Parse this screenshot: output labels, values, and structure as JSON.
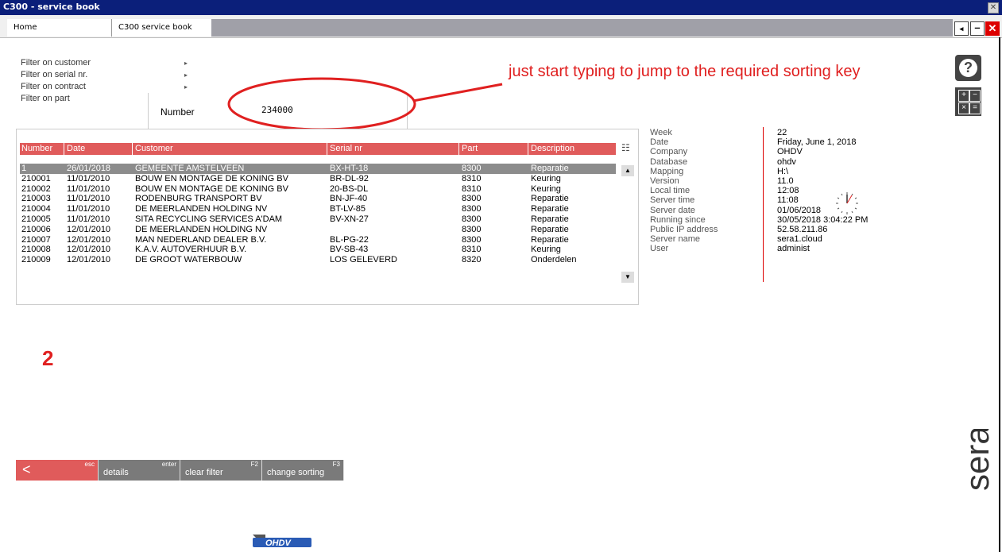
{
  "window": {
    "title": "C300 - service book",
    "close_glyph": "✕"
  },
  "tabs": [
    {
      "label": "Home"
    },
    {
      "label": "C300 service book"
    }
  ],
  "window_controls": {
    "back": "◂",
    "minimize": "–",
    "close": "✕"
  },
  "filters": [
    {
      "label": "Filter on customer"
    },
    {
      "label": "Filter on serial nr."
    },
    {
      "label": "Filter on contract"
    },
    {
      "label": "Filter on part"
    }
  ],
  "filter_arrow": "▸",
  "number_field": {
    "label": "Number",
    "value": "234000"
  },
  "annotation": {
    "text": "just start typing to jump to the required sorting key",
    "color": "#e02020",
    "step_label": "2"
  },
  "icons": {
    "help": "?",
    "calculator": [
      "+",
      "−",
      "×",
      "="
    ]
  },
  "table": {
    "columns": [
      "Number",
      "Date",
      "Customer",
      "Serial nr",
      "Part",
      "Description"
    ],
    "rows": [
      [
        "1",
        "26/01/2018",
        "GEMEENTE AMSTELVEEN",
        "BX-HT-18",
        "8300",
        "Reparatie"
      ],
      [
        "210001",
        "11/01/2010",
        "BOUW EN MONTAGE DE KONING BV",
        "BR-DL-92",
        "8310",
        "Keuring"
      ],
      [
        "210002",
        "11/01/2010",
        "BOUW EN MONTAGE DE KONING BV",
        "20-BS-DL",
        "8310",
        "Keuring"
      ],
      [
        "210003",
        "11/01/2010",
        "RODENBURG TRANSPORT BV",
        "BN-JF-40",
        "8300",
        "Reparatie"
      ],
      [
        "210004",
        "11/01/2010",
        "DE MEERLANDEN HOLDING NV",
        "BT-LV-85",
        "8300",
        "Reparatie"
      ],
      [
        "210005",
        "11/01/2010",
        "SITA RECYCLING SERVICES A'DAM",
        "BV-XN-27",
        "8300",
        "Reparatie"
      ],
      [
        "210006",
        "12/01/2010",
        "DE MEERLANDEN HOLDING NV",
        "",
        "8300",
        "Reparatie"
      ],
      [
        "210007",
        "12/01/2010",
        "MAN NEDERLAND DEALER B.V.",
        "BL-PG-22",
        "8300",
        "Reparatie"
      ],
      [
        "210008",
        "12/01/2010",
        "K.A.V. AUTOVERHUUR B.V.",
        "BV-SB-43",
        "8310",
        "Keuring"
      ],
      [
        "210009",
        "12/01/2010",
        "DE GROOT WATERBOUW",
        "LOS GELEVERD",
        "8320",
        "Onderdelen"
      ]
    ],
    "selected_row": 0,
    "header_color": "#e05b5b"
  },
  "info": [
    {
      "label": "Week",
      "value": "22"
    },
    {
      "label": "Date",
      "value": "Friday, June 1, 2018"
    },
    {
      "label": "Company",
      "value": "OHDV"
    },
    {
      "label": "Database",
      "value": "ohdv"
    },
    {
      "label": "Mapping",
      "value": "H:\\"
    },
    {
      "label": "Version",
      "value": "11.0"
    },
    {
      "label": "Local time",
      "value": "12:08"
    },
    {
      "label": "Server time",
      "value": "11:08"
    },
    {
      "label": "Server date",
      "value": "01/06/2018"
    },
    {
      "label": "Running since",
      "value": "30/05/2018 3:04:22 PM"
    },
    {
      "label": "Public IP address",
      "value": "52.58.211.86"
    },
    {
      "label": "Server name",
      "value": "sera1.cloud"
    },
    {
      "label": "User",
      "value": "administ"
    }
  ],
  "buttons": {
    "back": {
      "label": "<",
      "key": "esc"
    },
    "details": {
      "label": "details",
      "key": "enter"
    },
    "clear_filter": {
      "label": "clear filter",
      "key": "F2"
    },
    "change_sorting": {
      "label": "change sorting",
      "key": "F3"
    }
  },
  "brand": {
    "sera": "sera",
    "ohdv": "OHDV"
  }
}
